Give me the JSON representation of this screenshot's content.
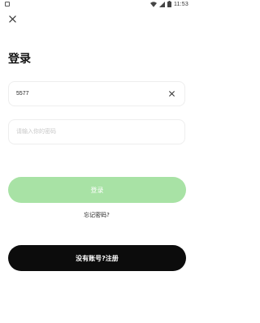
{
  "status_bar": {
    "time": "11:53",
    "app_icon": "notification-app-icon",
    "icons": [
      "wifi-icon",
      "signal-icon",
      "battery-icon"
    ]
  },
  "header": {
    "close_icon": "close-icon",
    "title": "登录"
  },
  "username": {
    "value": "5577",
    "clear_icon": "clear-icon"
  },
  "password": {
    "placeholder": "请输入你的密码",
    "value": ""
  },
  "actions": {
    "login_label": "登录",
    "forgot_label": "忘记密码?",
    "register_label": "没有账号?注册"
  },
  "colors": {
    "login_button": "#a8e2a5",
    "register_button": "#0c0c0c"
  }
}
